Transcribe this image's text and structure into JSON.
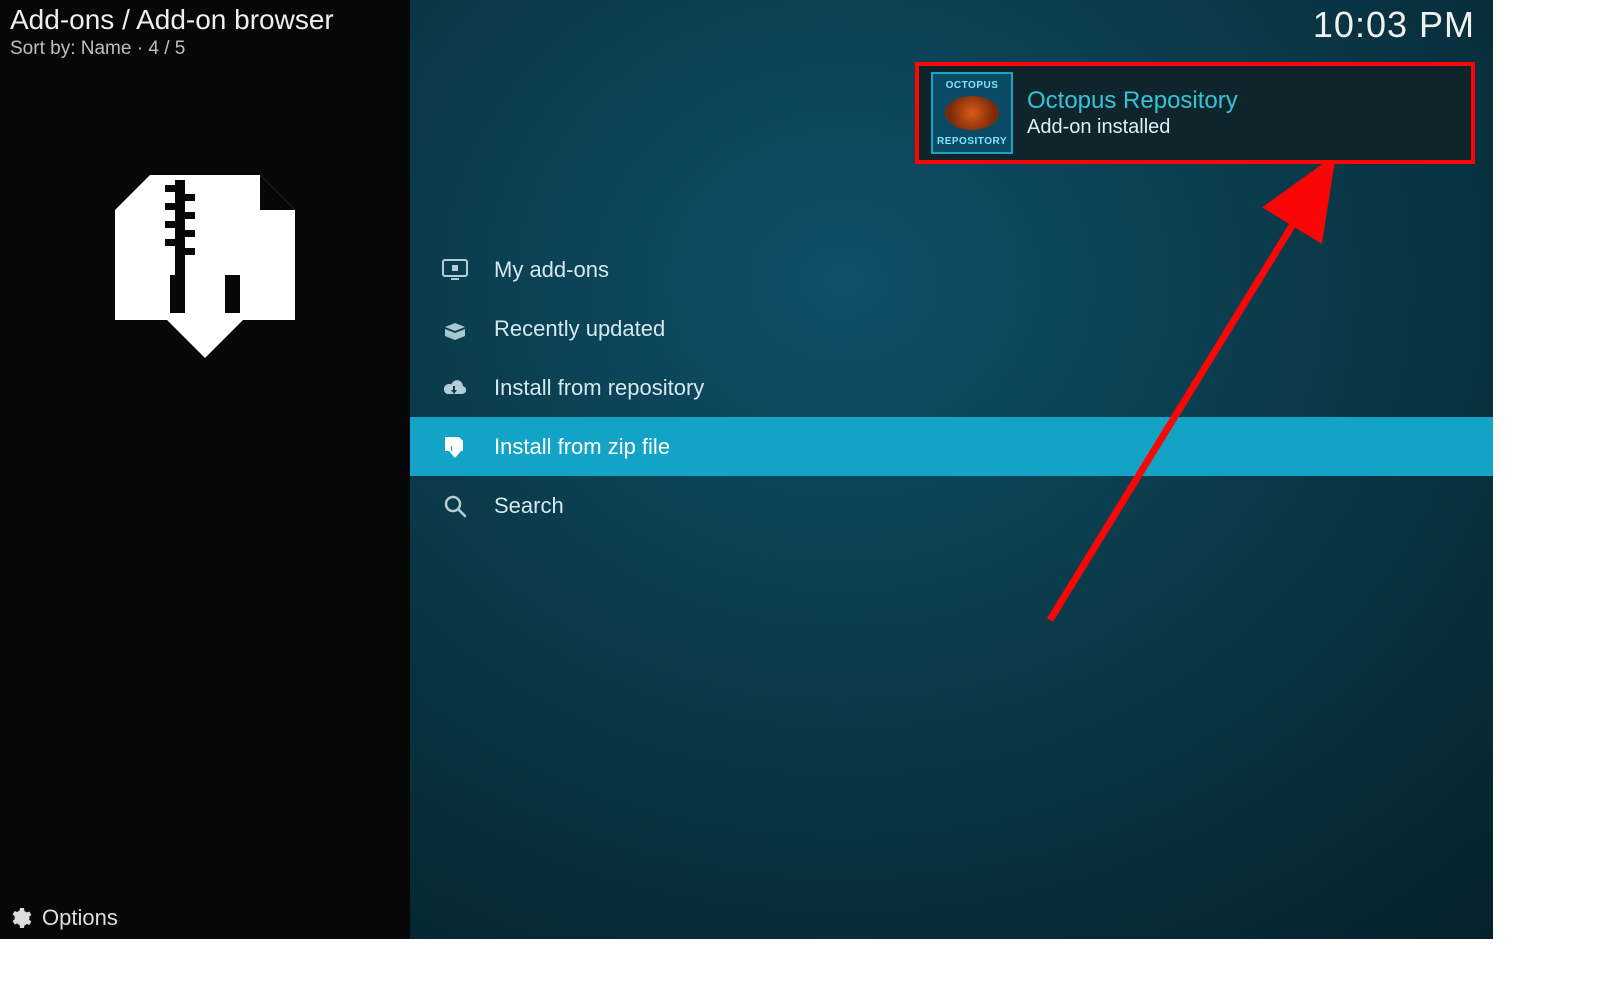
{
  "header": {
    "breadcrumb": "Add-ons / Add-on browser",
    "sort_label": "Sort by:",
    "sort_value": "Name",
    "position": "4 / 5",
    "clock": "10:03 PM"
  },
  "sidebar": {
    "options_label": "Options",
    "install_icon_name": "zip-download-icon"
  },
  "menu": {
    "items": [
      {
        "label": "My add-ons",
        "icon": "addons-icon",
        "selected": false
      },
      {
        "label": "Recently updated",
        "icon": "box-open-icon",
        "selected": false
      },
      {
        "label": "Install from repository",
        "icon": "cloud-down-icon",
        "selected": false
      },
      {
        "label": "Install from zip file",
        "icon": "zip-file-icon",
        "selected": true
      },
      {
        "label": "Search",
        "icon": "search-icon",
        "selected": false
      }
    ]
  },
  "notification": {
    "title": "Octopus Repository",
    "subtitle": "Add-on installed",
    "thumb_top": "OCTOPUS",
    "thumb_bottom": "REPOSITORY"
  },
  "colors": {
    "accent": "#13a3c7",
    "notif_title": "#34c4d8",
    "highlight_border": "#fb0606"
  }
}
